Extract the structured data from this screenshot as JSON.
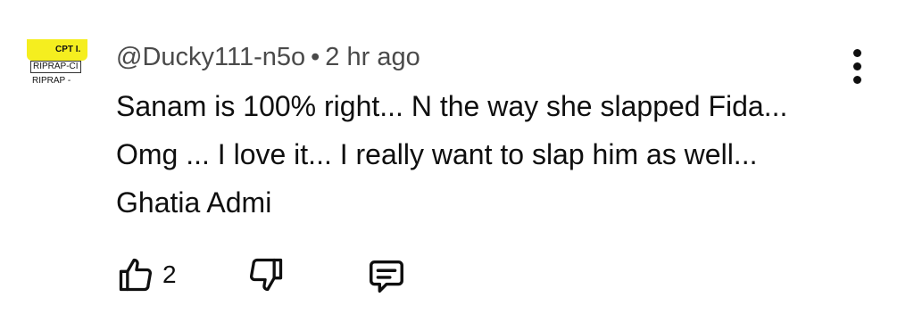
{
  "avatar": {
    "line1": "CPT I.",
    "line2": "RIPRAP-CI",
    "line3": "RIPRAP -"
  },
  "comment": {
    "author": "@Ducky111-n5o",
    "separator": "•",
    "timestamp": "2 hr ago",
    "text": "Sanam is 100% right... N the way she slapped Fida... Omg ... I love it... I really want to slap him as well... Ghatia Admi",
    "like_count": "2"
  },
  "icons": {
    "like": "thumbs-up-icon",
    "dislike": "thumbs-down-icon",
    "reply": "reply-comment-icon",
    "more": "more-vertical-icon"
  }
}
